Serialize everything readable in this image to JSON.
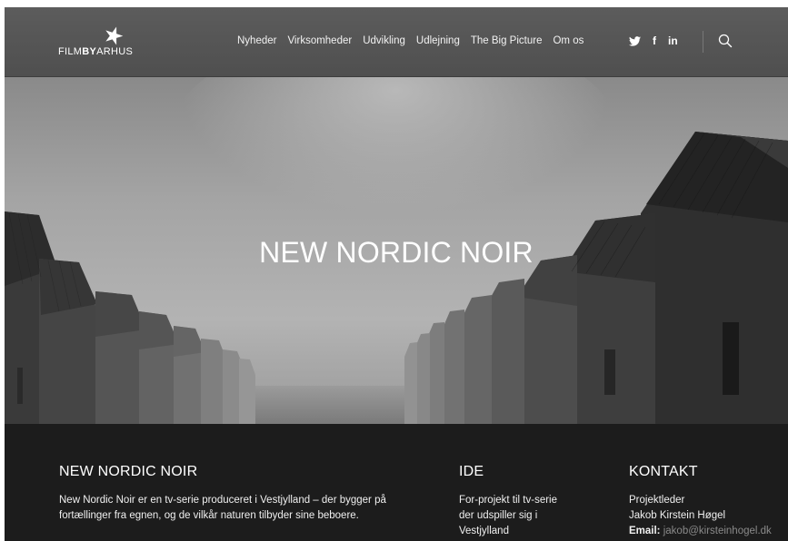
{
  "header": {
    "logo": {
      "text_part1": "FILM",
      "text_part2": "BY",
      "text_part3": "ARHUS"
    },
    "nav": [
      {
        "label": "Nyheder"
      },
      {
        "label": "Virksomheder"
      },
      {
        "label": "Udvikling"
      },
      {
        "label": "Udlejning"
      },
      {
        "label": "The Big Picture"
      },
      {
        "label": "Om os"
      }
    ],
    "social": {
      "twitter": "♥",
      "facebook": "f",
      "linkedin": "in"
    },
    "search_icon": "search-icon"
  },
  "hero": {
    "title": "NEW NORDIC NOIR"
  },
  "info": {
    "about": {
      "heading": "NEW NORDIC NOIR",
      "text": "New Nordic Noir er en tv-serie produceret i Vestjylland – der bygger på fortællinger fra egnen, og de vilkår naturen tilbyder sine beboere."
    },
    "idea": {
      "heading": "IDE",
      "text": "For-projekt til tv-serie der udspiller sig i Vestjylland"
    },
    "contact": {
      "heading": "KONTAKT",
      "role": "Projektleder",
      "name": "Jakob Kirstein Høgel",
      "email_label": "Email:",
      "email": "jakob@kirsteinhogel.dk"
    }
  },
  "colors": {
    "header_bg": "#555555",
    "info_bg": "#1c1c1c",
    "email_link": "#8a8a8a"
  }
}
